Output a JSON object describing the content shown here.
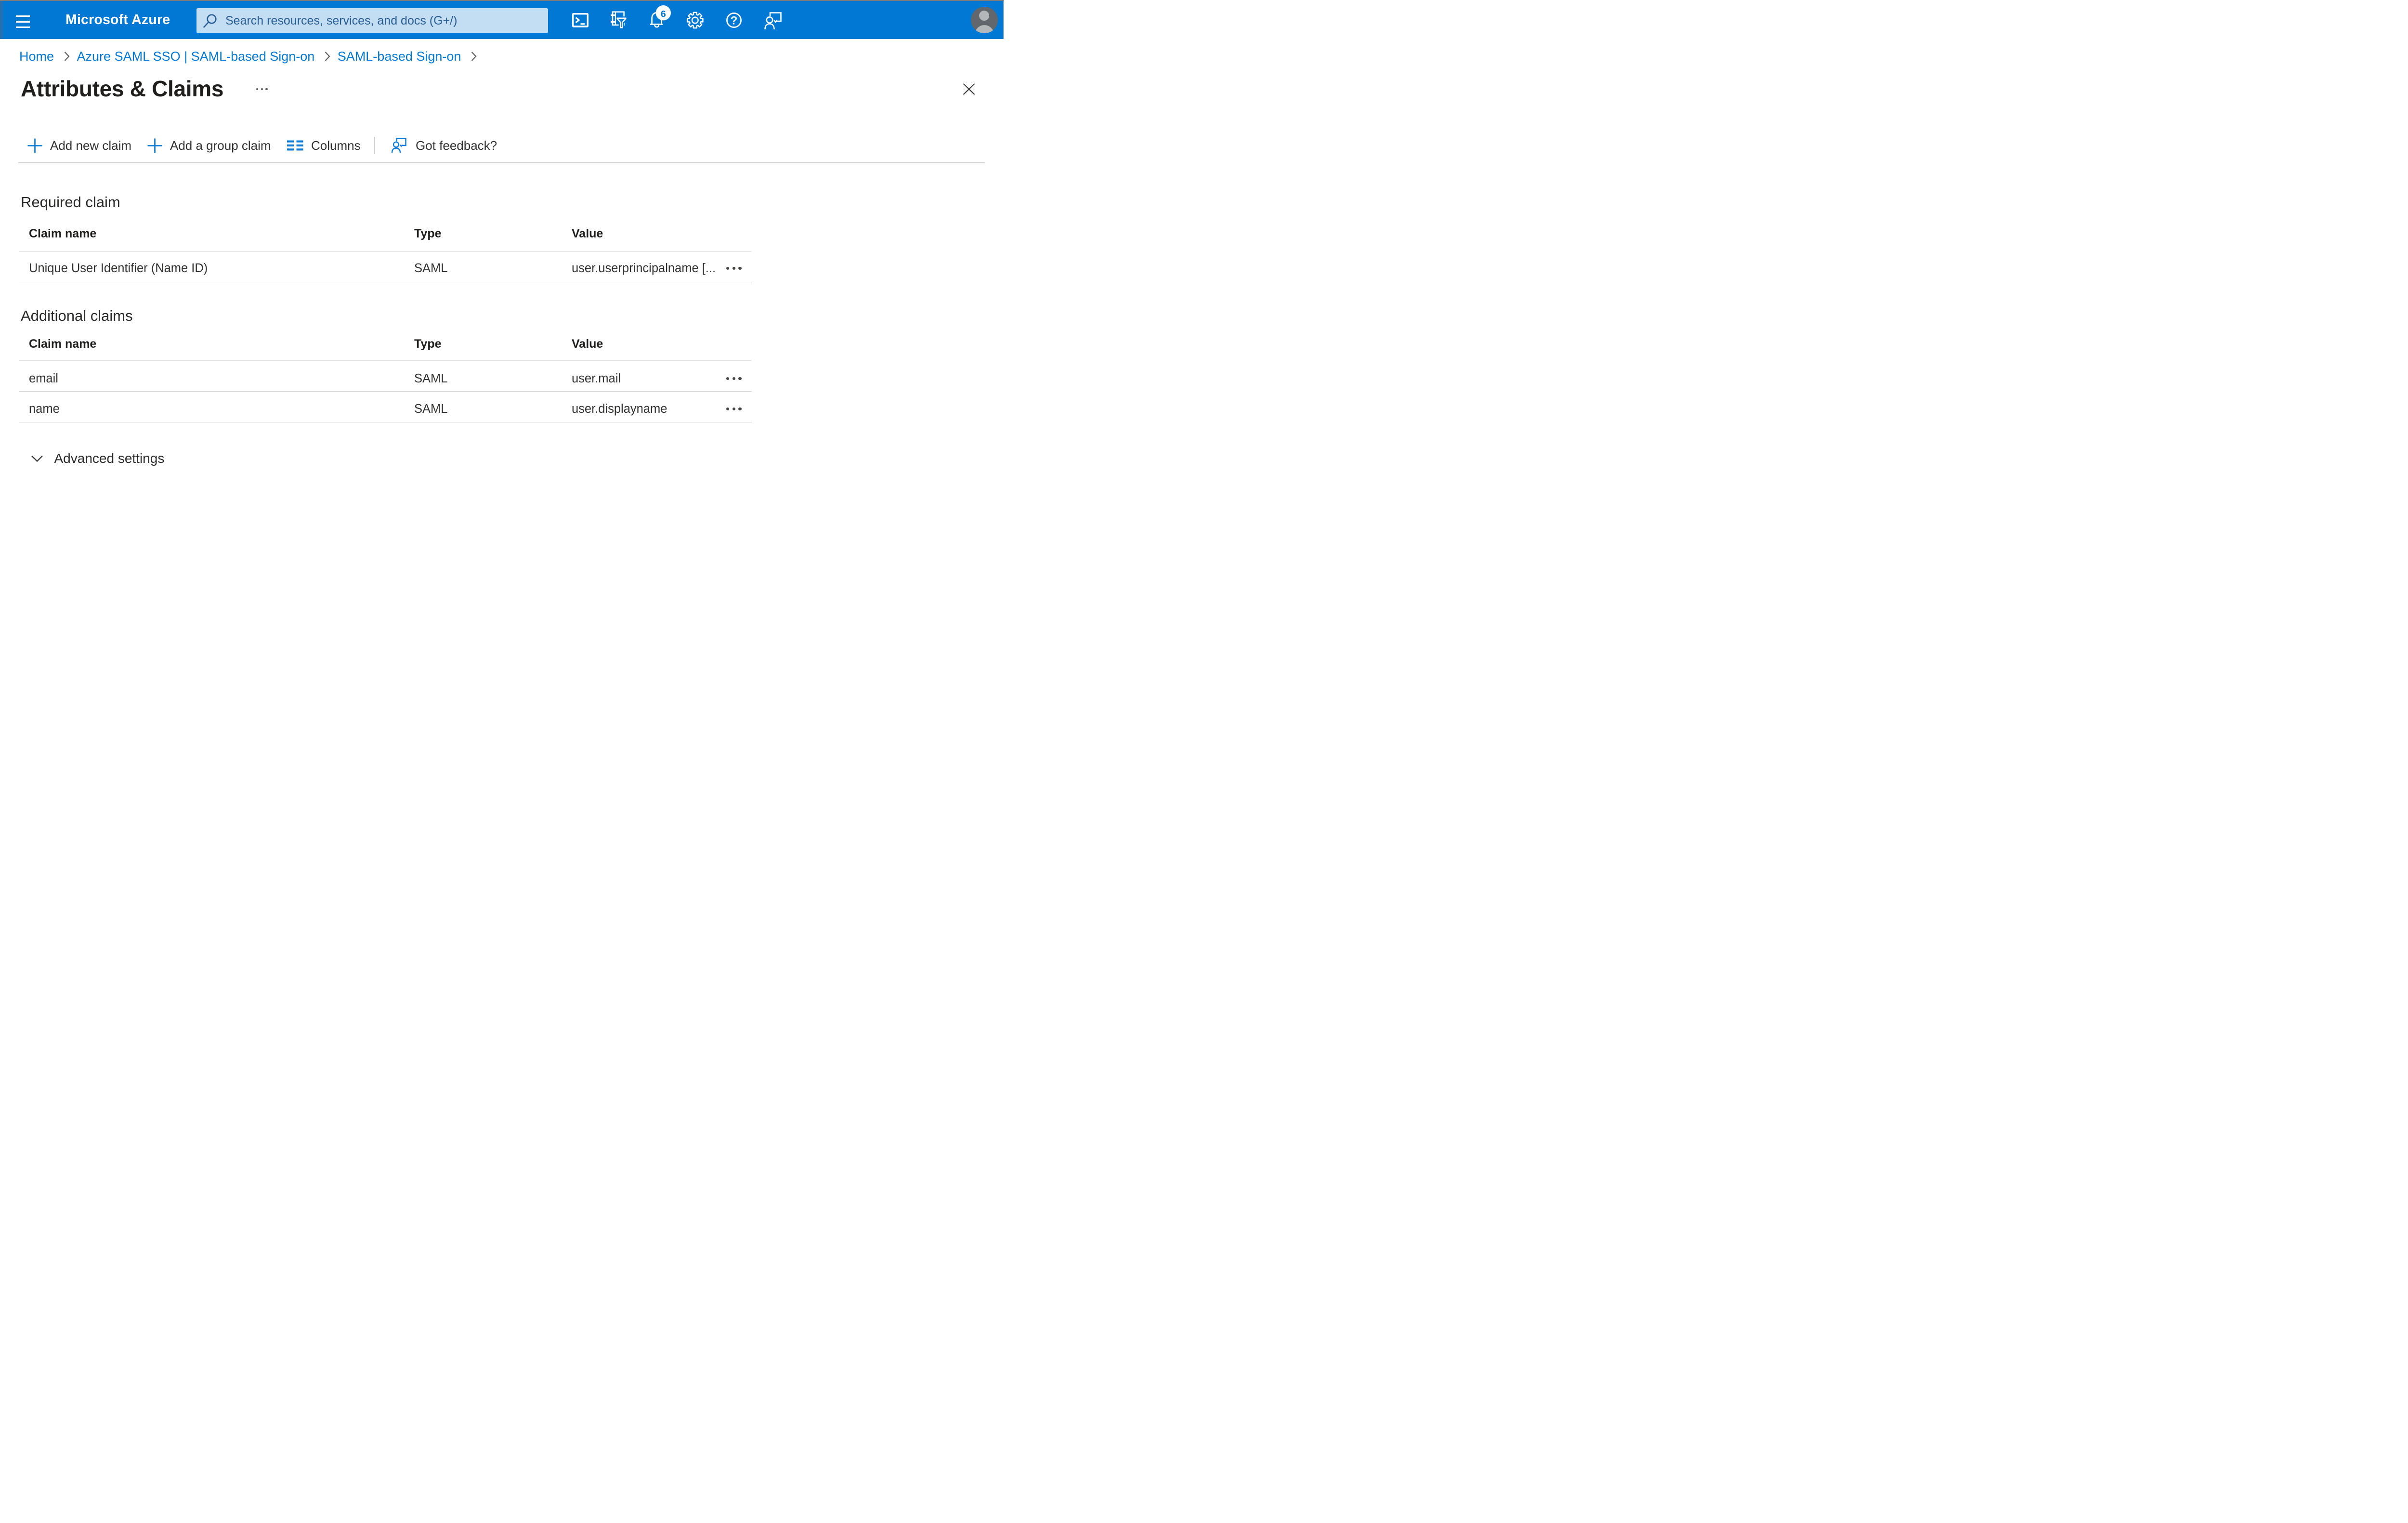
{
  "topbar": {
    "brand": "Microsoft Azure",
    "search_placeholder": "Search resources, services, and docs (G+/)",
    "notification_count": "6",
    "icons": [
      "hamburger-menu-icon",
      "search-icon",
      "cloud-shell-icon",
      "directory-filter-icon",
      "notifications-bell-icon",
      "settings-gear-icon",
      "help-icon",
      "feedback-icon",
      "avatar"
    ]
  },
  "breadcrumb": {
    "items": [
      {
        "label": "Home"
      },
      {
        "label": "Azure SAML SSO | SAML-based Sign-on"
      },
      {
        "label": "SAML-based Sign-on"
      }
    ]
  },
  "page": {
    "title": "Attributes & Claims"
  },
  "toolbar": {
    "add_new_claim": "Add new claim",
    "add_group_claim": "Add a group claim",
    "columns": "Columns",
    "got_feedback": "Got feedback?"
  },
  "sections": {
    "required": {
      "heading": "Required claim",
      "columns": {
        "claim": "Claim name",
        "type": "Type",
        "value": "Value"
      },
      "rows": [
        {
          "claim": "Unique User Identifier (Name ID)",
          "type": "SAML",
          "value": "user.userprincipalname [..."
        }
      ]
    },
    "additional": {
      "heading": "Additional claims",
      "columns": {
        "claim": "Claim name",
        "type": "Type",
        "value": "Value"
      },
      "rows": [
        {
          "claim": "email",
          "type": "SAML",
          "value": "user.mail"
        },
        {
          "claim": "name",
          "type": "SAML",
          "value": "user.displayname"
        }
      ]
    }
  },
  "advanced_settings": {
    "label": "Advanced settings"
  },
  "colors": {
    "accent": "#0078d4",
    "topbar": "#0078d4",
    "search_bg": "#c3ddf2",
    "search_text": "#275d93",
    "text_primary": "#323130",
    "text_title": "#201f1e",
    "separator": "#cfcdcb",
    "avatar_bg": "#61676c",
    "avatar_fg": "#b4b7b9"
  }
}
